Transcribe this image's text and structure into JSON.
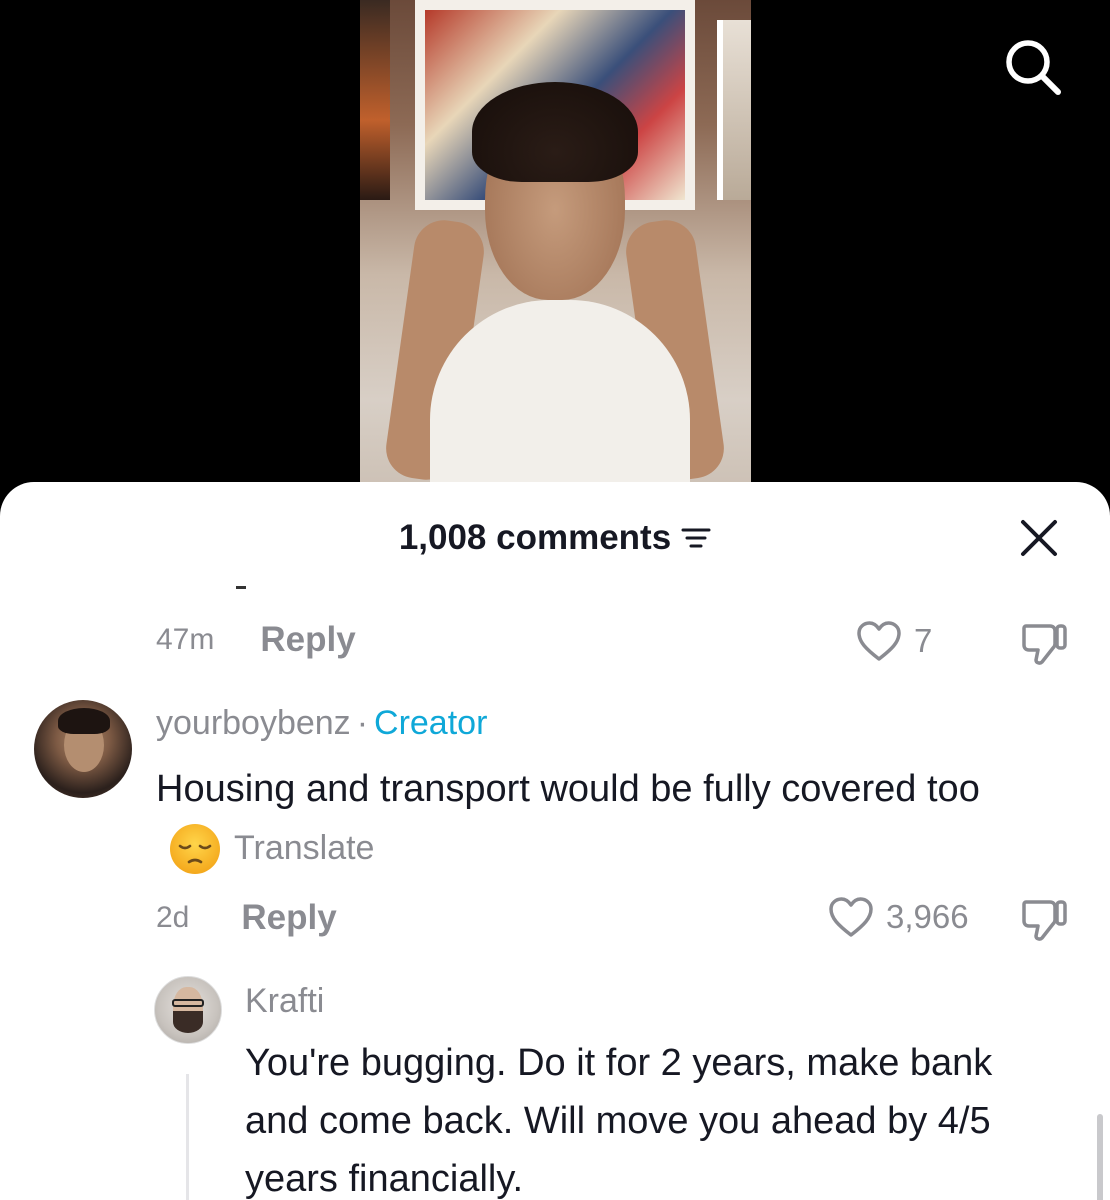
{
  "video": {
    "search_icon": "search-icon"
  },
  "comments_header": {
    "count_label": "1,008 comments",
    "filter_icon": "sort-lines-icon",
    "close_icon": "close-icon"
  },
  "previous_comment": {
    "time": "47m",
    "reply_label": "Reply",
    "likes": "7",
    "like_icon": "heart-outline-icon",
    "dislike_icon": "thumbs-down-icon"
  },
  "comments": [
    {
      "username": "yourboybenz",
      "separator": "·",
      "badge": "Creator",
      "text": "Housing and transport would be fully covered too",
      "emoji": "pensive-face-emoji",
      "translate_label": "Translate",
      "time": "2d",
      "reply_label": "Reply",
      "likes": "3,966",
      "like_icon": "heart-outline-icon",
      "dislike_icon": "thumbs-down-icon"
    },
    {
      "username": "Krafti",
      "text": "You're bugging. Do it for 2 years, make bank and come back. Will move you ahead by 4/5 years financially."
    }
  ],
  "colors": {
    "text_primary": "#161823",
    "text_secondary": "#8a8b91",
    "creator_accent": "#0fa8d8",
    "background_top": "#000000",
    "sheet_background": "#ffffff"
  }
}
